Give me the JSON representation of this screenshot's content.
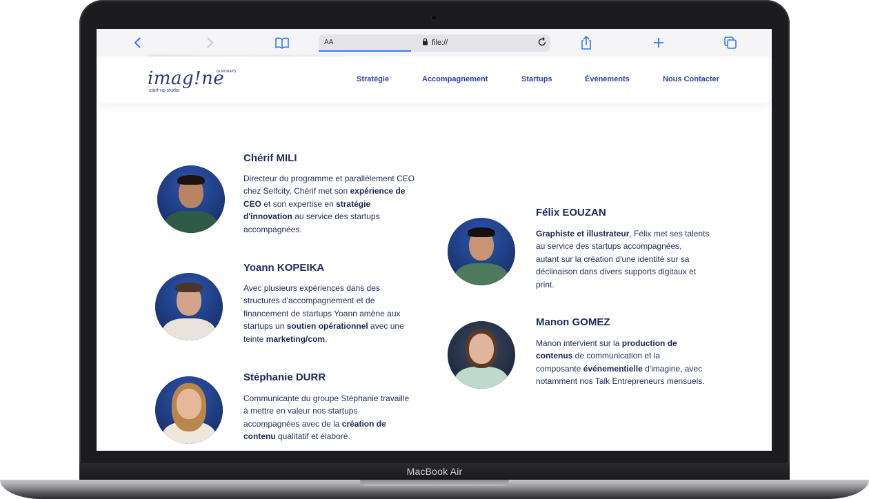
{
  "device": {
    "label": "MacBook Air"
  },
  "browser": {
    "aa_label": "AA",
    "url": "file://",
    "back_icon": "chevron-left-icon",
    "forward_icon": "chevron-right-icon",
    "bookmarks_icon": "book-icon",
    "reload_icon": "reload-icon",
    "share_icon": "share-icon",
    "new_tab_icon": "plus-icon",
    "tabs_icon": "tabs-icon",
    "accent": "#2f7cf6"
  },
  "site": {
    "logo": {
      "word": "imag!ne",
      "by": "by MONAPS",
      "tagline": "start-up studio"
    },
    "nav": [
      "Stratégie",
      "Accompagnement",
      "Startups",
      "Événements",
      "Nous Contacter"
    ],
    "nav_color": "#2a44a8"
  },
  "team": [
    {
      "name": "Chérif MILI",
      "bio": [
        "Directeur du programme et parallèlement CEO",
        "chez Selfcity, Chérif met son |expérience de|",
        "|CEO| et son expertise en |stratégie|",
        "|d'innovation| au service des startups",
        "accompagnées."
      ]
    },
    {
      "name": "Yoann KOPEIKA",
      "bio": [
        "Avec plusieurs expériences dans des",
        "structures d'accompagnement et de",
        "financement de startups Yoann amène aux",
        "startups un |soutien opérationnel| avec une",
        "teinte |marketing/com|."
      ]
    },
    {
      "name": "Stéphanie DURR",
      "bio": [
        "Communicante du groupe Stéphanie travaille",
        "à mettre en valeur nos startups",
        "accompagnées avec de la |création de|",
        "|contenu| qualitatif et élaboré."
      ]
    },
    {
      "name": "Félix EOUZAN",
      "bio": [
        "|Graphiste et illustrateur|, Félix met ses talents",
        "au service des startups accompagnées,",
        "autant sur la création d'une identité sur sa",
        "déclinaison dans divers supports digitaux et",
        "print."
      ]
    },
    {
      "name": "Manon GOMEZ",
      "bio": [
        "Manon intervient sur la |production de|",
        "|contenus| de communication et la",
        "composante |événementielle| d'imagine, avec",
        "notamment nos Talk Entrepreneurs mensuels."
      ]
    }
  ]
}
